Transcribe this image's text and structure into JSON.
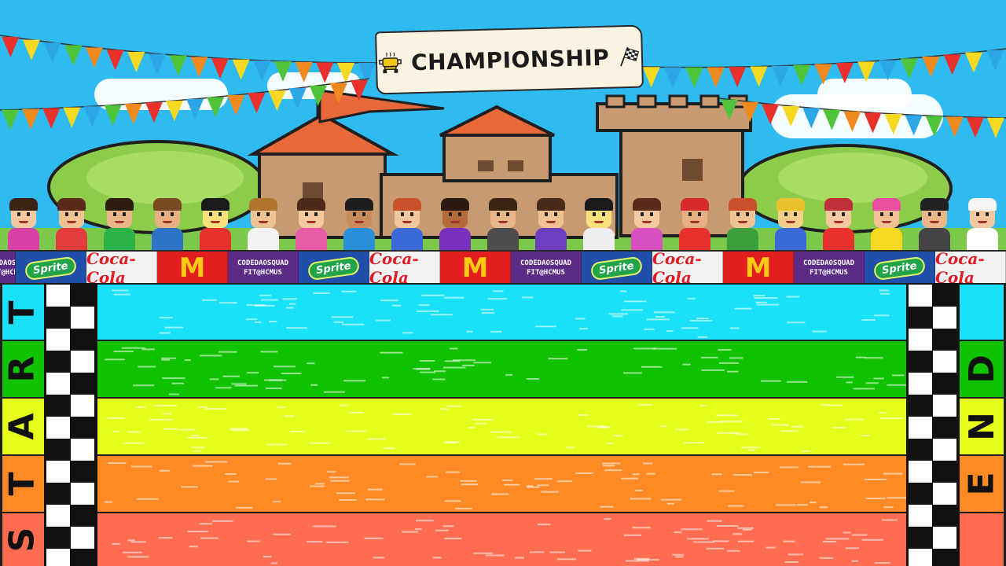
{
  "header": {
    "title": "CHAMPIONSHIP",
    "icons": [
      "trophy-icon",
      "checkered-flag-icon"
    ]
  },
  "sponsors": [
    {
      "type": "code",
      "line1": "CODEDAOSQUAD",
      "line2": "FIT@HCMUS"
    },
    {
      "type": "sprite",
      "label": "Sprite"
    },
    {
      "type": "coke",
      "label": "Coca-Cola"
    },
    {
      "type": "mc",
      "label": "M"
    },
    {
      "type": "code",
      "line1": "CODEDAOSQUAD",
      "line2": "FIT@HCMUS"
    },
    {
      "type": "sprite",
      "label": "Sprite"
    },
    {
      "type": "coke",
      "label": "Coca-Cola"
    },
    {
      "type": "mc",
      "label": "M"
    },
    {
      "type": "code",
      "line1": "CODEDAOSQUAD",
      "line2": "FIT@HCMUS"
    },
    {
      "type": "sprite",
      "label": "Sprite"
    },
    {
      "type": "coke",
      "label": "Coca-Cola"
    },
    {
      "type": "mc",
      "label": "M"
    },
    {
      "type": "code",
      "line1": "CODEDAOSQUAD",
      "line2": "FIT@HCMUS"
    },
    {
      "type": "sprite",
      "label": "Sprite"
    },
    {
      "type": "coke",
      "label": "Coca-Cola"
    }
  ],
  "track": {
    "lanes": [
      {
        "color": "#19e1f7"
      },
      {
        "color": "#10c200"
      },
      {
        "color": "#e5ff1a"
      },
      {
        "color": "#ff8a25"
      },
      {
        "color": "#ff6d50"
      }
    ],
    "start_letters": [
      "T",
      "R",
      "A",
      "T",
      "S"
    ],
    "end_letters": [
      "",
      "D",
      "N",
      "E",
      ""
    ]
  },
  "colors": {
    "sky": "#2fbaf0",
    "bunting": [
      "#e8302c",
      "#f5d820",
      "#2da6e8",
      "#4fc43a",
      "#f08a1e"
    ]
  },
  "crowd": [
    {
      "skin": "#f4c9a0",
      "hair": "#3b2314",
      "shirt": "#d940a8"
    },
    {
      "skin": "#f1c193",
      "hair": "#5a2a1a",
      "shirt": "#e23b3b"
    },
    {
      "skin": "#eab78a",
      "hair": "#2f1c10",
      "shirt": "#2bb34a"
    },
    {
      "skin": "#e7b083",
      "hair": "#7a4a22",
      "shirt": "#2d74c7"
    },
    {
      "skin": "#f8e07a",
      "hair": "#1b1b1b",
      "shirt": "#e8302c"
    },
    {
      "skin": "#f0c292",
      "hair": "#b0752c",
      "shirt": "#f2f2f2"
    },
    {
      "skin": "#f4c9a0",
      "hair": "#4b2a18",
      "shirt": "#e85aa6"
    },
    {
      "skin": "#c98a5c",
      "hair": "#1e1e1e",
      "shirt": "#2a8fd9"
    },
    {
      "skin": "#f2c79b",
      "hair": "#c8502a",
      "shirt": "#3a69d8"
    },
    {
      "skin": "#b46a3a",
      "hair": "#2a1a10",
      "shirt": "#7a2fbf"
    },
    {
      "skin": "#eab78a",
      "hair": "#3a2414",
      "shirt": "#4d4d4d"
    },
    {
      "skin": "#f0c292",
      "hair": "#4a2a18",
      "shirt": "#6d3fbf"
    },
    {
      "skin": "#f8e07a",
      "hair": "#1b1b1b",
      "shirt": "#eeeeee"
    },
    {
      "skin": "#f4c9a0",
      "hair": "#5a2a1a",
      "shirt": "#d94fc1"
    },
    {
      "skin": "#e7b083",
      "hair": "#d52b2b",
      "shirt": "#e8302c"
    },
    {
      "skin": "#f0c292",
      "hair": "#c8502a",
      "shirt": "#3a9f3a"
    },
    {
      "skin": "#f2d08a",
      "hair": "#e8c22c",
      "shirt": "#3a69d8"
    },
    {
      "skin": "#f4c9a0",
      "hair": "#c0303a",
      "shirt": "#e8302c"
    },
    {
      "skin": "#f1c193",
      "hair": "#e84fa0",
      "shirt": "#f5d820"
    },
    {
      "skin": "#eab78a",
      "hair": "#222222",
      "shirt": "#444444"
    },
    {
      "skin": "#f4c9a0",
      "hair": "#f4f4f4",
      "shirt": "#ffffff"
    }
  ]
}
